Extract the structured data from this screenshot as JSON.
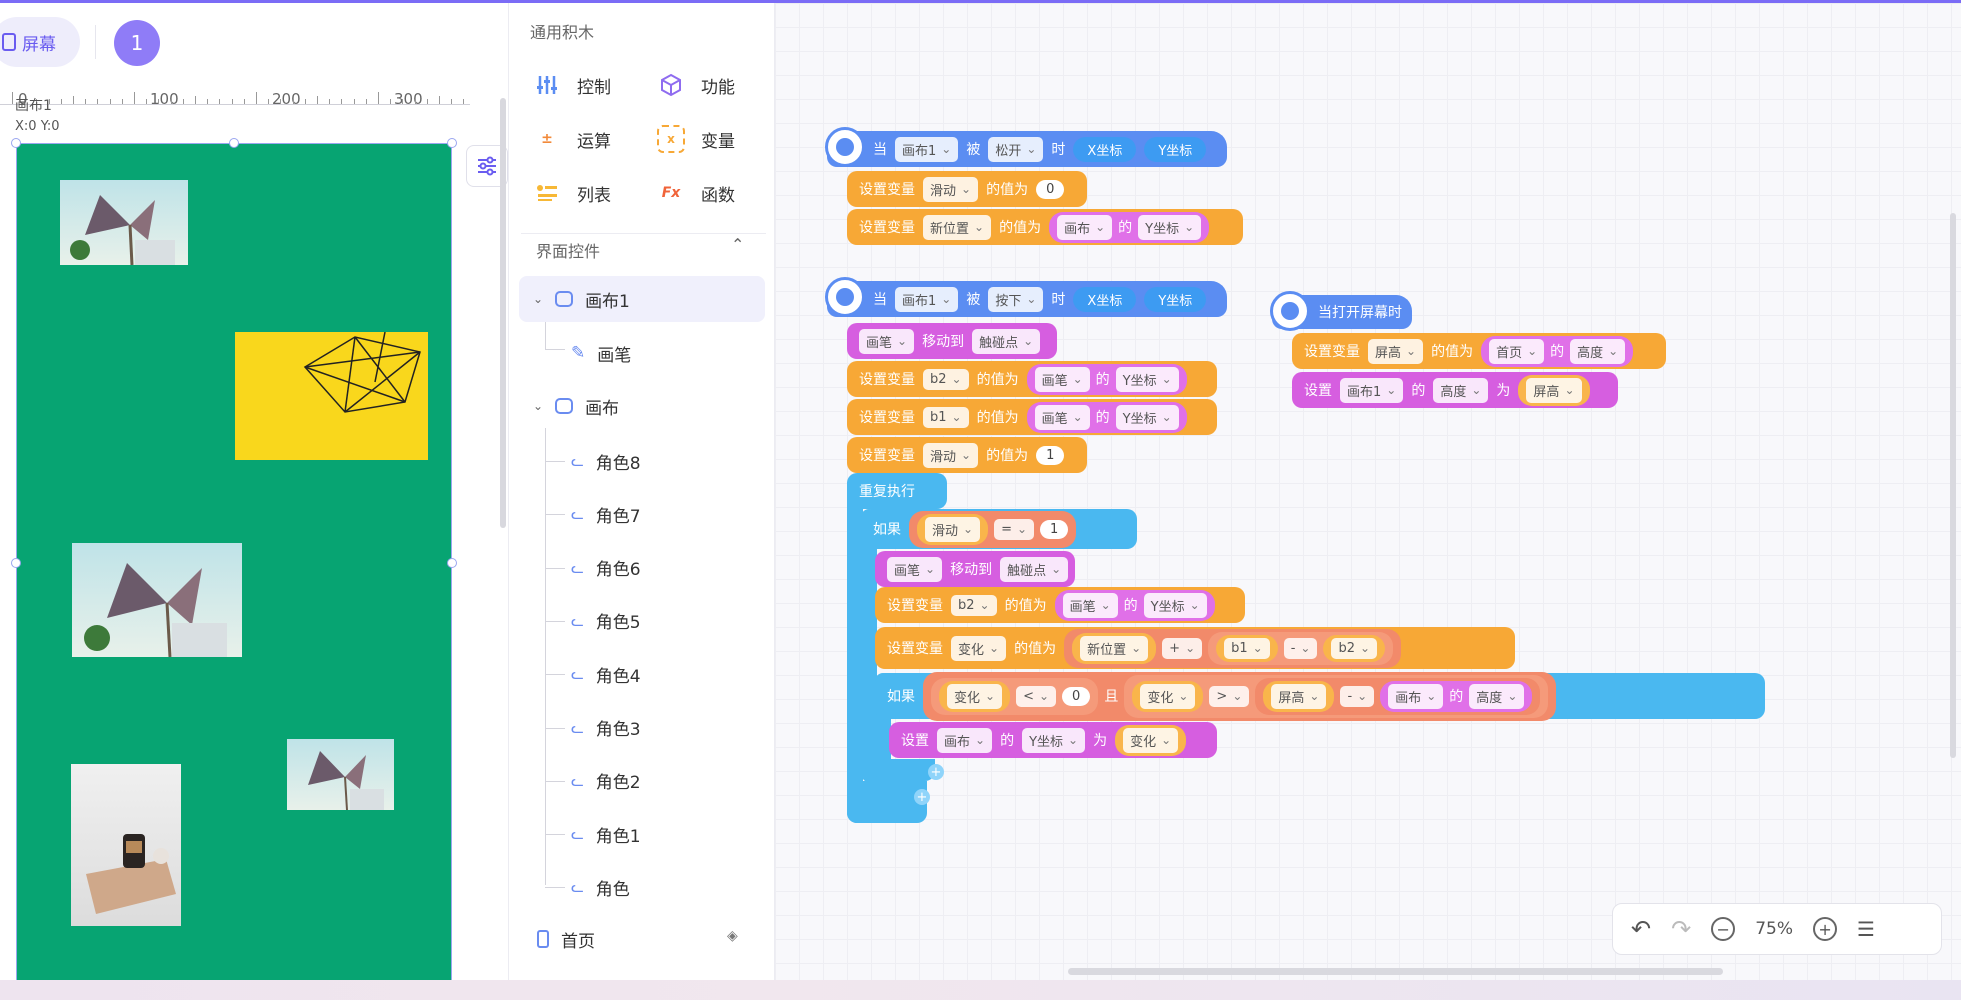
{
  "toolbar": {
    "screen_label": "屏幕",
    "screen_number": "1"
  },
  "ruler": {
    "labels": [
      "0",
      "100",
      "200",
      "300"
    ]
  },
  "stage": {
    "canvas_name": "画布1",
    "coords": "X:0 Y:0",
    "canvas_color": "#07a472"
  },
  "blocks_panel": {
    "general_title": "通用积木",
    "categories": [
      {
        "label": "控制",
        "icon": "sliders-icon",
        "color": "#5b8df2"
      },
      {
        "label": "功能",
        "icon": "cube-icon",
        "color": "#8f6cf0"
      },
      {
        "label": "运算",
        "icon": "math-icon",
        "color": "#f28a3a"
      },
      {
        "label": "变量",
        "icon": "variable-icon",
        "color": "#f7a836"
      },
      {
        "label": "列表",
        "icon": "list-icon",
        "color": "#f7b836"
      },
      {
        "label": "函数",
        "icon": "function-icon",
        "color": "#f0643a"
      }
    ],
    "ui_title": "界面控件",
    "tree": [
      {
        "label": "画布1"
      },
      {
        "label": "画笔"
      },
      {
        "label": "画布"
      },
      {
        "label": "角色8"
      },
      {
        "label": "角色7"
      },
      {
        "label": "角色6"
      },
      {
        "label": "角色5"
      },
      {
        "label": "角色4"
      },
      {
        "label": "角色3"
      },
      {
        "label": "角色2"
      },
      {
        "label": "角色1"
      },
      {
        "label": "角色"
      },
      {
        "label": "首页"
      }
    ]
  },
  "blocks": {
    "w": {
      "dang": "当",
      "bei": "被",
      "shi": "时",
      "set_var": "设置变量",
      "value_of": "的值为",
      "of": "的",
      "move_to": "移动到",
      "repeat": "重复执行",
      "if": "如果",
      "set": "设置",
      "as": "为",
      "and": "且",
      "on_open": "当打开屏幕时"
    },
    "n": {
      "canvas1": "画布1",
      "canvas": "画布",
      "pen": "画笔",
      "home": "首页",
      "release": "松开",
      "press": "按下",
      "x": "X坐标",
      "y": "Y坐标",
      "touch": "触碰点",
      "slide": "滑动",
      "newpos": "新位置",
      "b1": "b1",
      "b2": "b2",
      "change": "变化",
      "screenh": "屏高",
      "height": "高度",
      "eq": "=",
      "lt": "<",
      "gt": ">",
      "plus": "+",
      "minus": "-",
      "zero": "0",
      "one": "1"
    }
  },
  "zoom": {
    "level": "75%"
  }
}
